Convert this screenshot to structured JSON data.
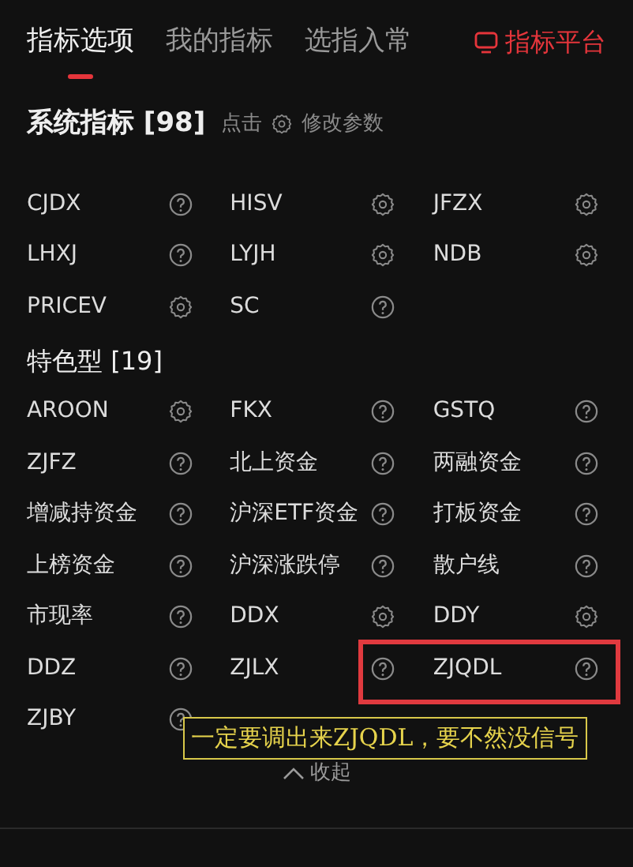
{
  "tabs": [
    {
      "label": "指标选项",
      "selected": true
    },
    {
      "label": "我的指标",
      "selected": false
    },
    {
      "label": "选指入常",
      "selected": false
    }
  ],
  "platform_link": {
    "label": "指标平台"
  },
  "header": {
    "title": "系统指标 [98]",
    "hint_before": "点击",
    "hint_after": "修改参数"
  },
  "groups": [
    {
      "items": [
        {
          "name": "CJDX",
          "kind": "help"
        },
        {
          "name": "HISV",
          "kind": "settings"
        },
        {
          "name": "JFZX",
          "kind": "settings"
        },
        {
          "name": "LHXJ",
          "kind": "help"
        },
        {
          "name": "LYJH",
          "kind": "settings"
        },
        {
          "name": "NDB",
          "kind": "settings"
        },
        {
          "name": "PRICEV",
          "kind": "settings"
        },
        {
          "name": "SC",
          "kind": "help"
        }
      ]
    },
    {
      "title": "特色型 [19]",
      "items": [
        {
          "name": "AROON",
          "kind": "settings"
        },
        {
          "name": "FKX",
          "kind": "help"
        },
        {
          "name": "GSTQ",
          "kind": "help"
        },
        {
          "name": "ZJFZ",
          "kind": "help"
        },
        {
          "name": "北上资金",
          "kind": "help"
        },
        {
          "name": "两融资金",
          "kind": "help"
        },
        {
          "name": "增减持资金",
          "kind": "help"
        },
        {
          "name": "沪深ETF资金",
          "kind": "help"
        },
        {
          "name": "打板资金",
          "kind": "help"
        },
        {
          "name": "上榜资金",
          "kind": "help"
        },
        {
          "name": "沪深涨跌停",
          "kind": "help"
        },
        {
          "name": "散户线",
          "kind": "help"
        },
        {
          "name": "市现率",
          "kind": "help"
        },
        {
          "name": "DDX",
          "kind": "settings"
        },
        {
          "name": "DDY",
          "kind": "settings"
        },
        {
          "name": "DDZ",
          "kind": "help"
        },
        {
          "name": "ZJLX",
          "kind": "help"
        },
        {
          "name": "ZJQDL",
          "kind": "help",
          "highlighted": true
        },
        {
          "name": "ZJBY",
          "kind": "help"
        }
      ]
    }
  ],
  "annotation": {
    "text": "一定要调出来ZJQDL，要不然没信号"
  },
  "collapse": {
    "label": "收起"
  }
}
